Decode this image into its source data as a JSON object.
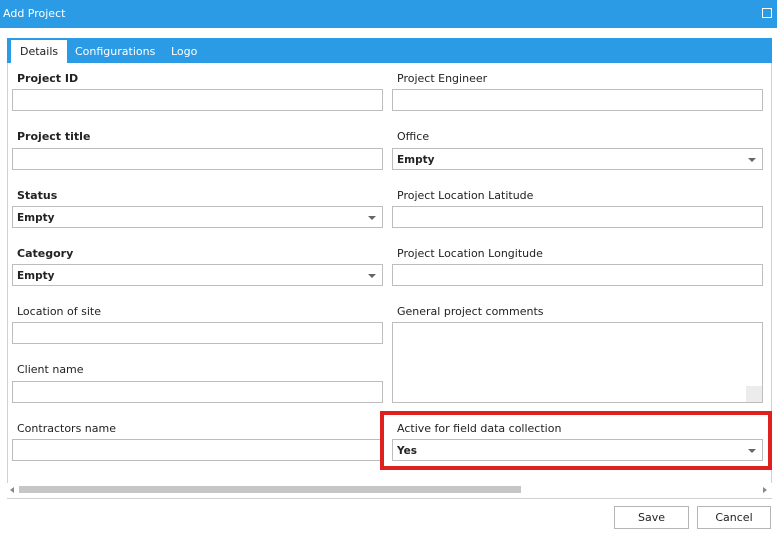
{
  "window": {
    "title": "Add Project"
  },
  "tabs": [
    {
      "label": "Details",
      "active": true
    },
    {
      "label": "Configurations",
      "active": false
    },
    {
      "label": "Logo",
      "active": false
    }
  ],
  "form": {
    "project_id": {
      "label": "Project ID",
      "value": ""
    },
    "project_title": {
      "label": "Project title",
      "value": ""
    },
    "status": {
      "label": "Status",
      "selected": "Empty"
    },
    "category": {
      "label": "Category",
      "selected": "Empty"
    },
    "location_of_site": {
      "label": "Location of site",
      "value": ""
    },
    "client_name": {
      "label": "Client name",
      "value": ""
    },
    "contractors_name": {
      "label": "Contractors name",
      "value": ""
    },
    "project_engineer": {
      "label": "Project Engineer",
      "value": ""
    },
    "office": {
      "label": "Office",
      "selected": "Empty"
    },
    "latitude": {
      "label": "Project Location Latitude",
      "value": ""
    },
    "longitude": {
      "label": "Project Location Longitude",
      "value": ""
    },
    "comments": {
      "label": "General project comments",
      "value": ""
    },
    "active_field_collection": {
      "label": "Active for field data collection",
      "selected": "Yes"
    }
  },
  "buttons": {
    "save": "Save",
    "cancel": "Cancel"
  },
  "colors": {
    "accent": "#2b9be6",
    "highlight": "#e0201f"
  }
}
